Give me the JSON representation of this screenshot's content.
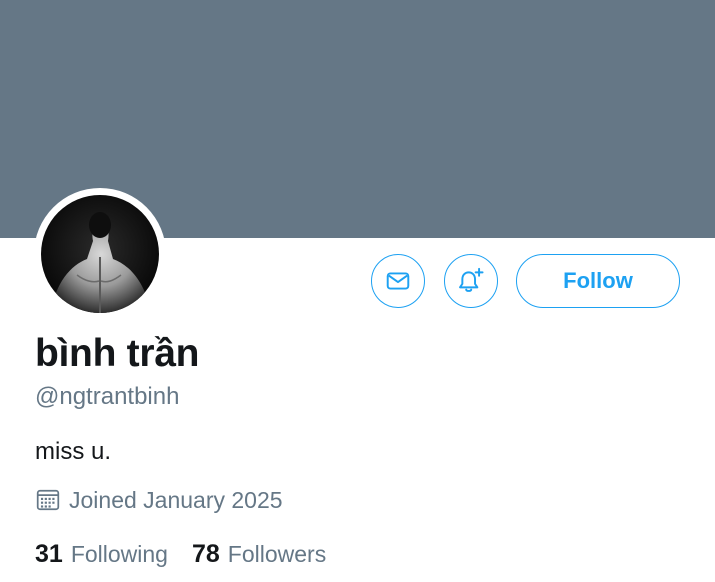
{
  "profile": {
    "display_name": "bình trần",
    "handle": "@ngtrantbinh",
    "bio": "miss u.",
    "joined": "Joined January 2025",
    "banner_color": "#657786"
  },
  "actions": {
    "message_icon": "envelope-icon",
    "notify_icon": "bell-plus-icon",
    "follow_label": "Follow",
    "accent_color": "#1da1f2"
  },
  "stats": {
    "following_count": "31",
    "following_label": "Following",
    "followers_count": "78",
    "followers_label": "Followers"
  },
  "icons": {
    "calendar": "calendar-icon"
  }
}
